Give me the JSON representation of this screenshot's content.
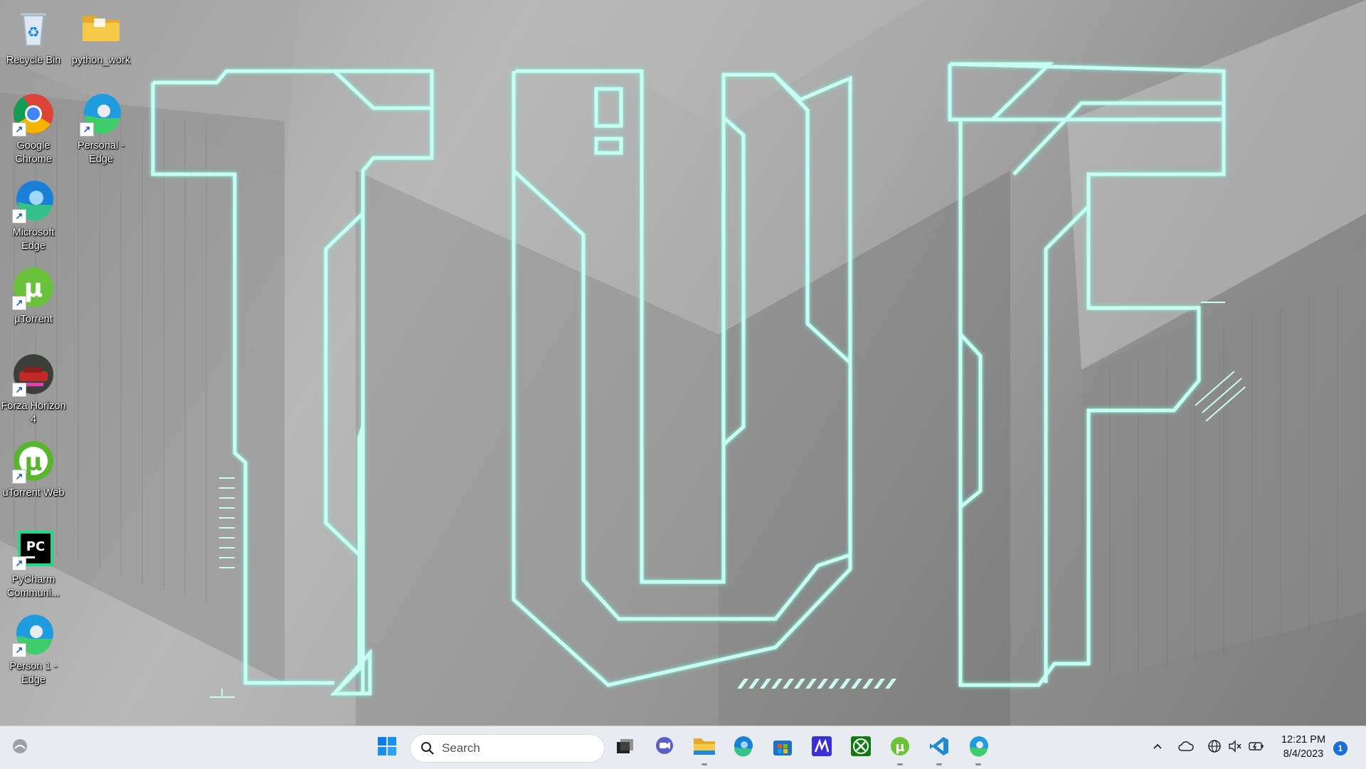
{
  "desktop": {
    "wallpaper_text": "TUF",
    "accent_color": "#c9fff2",
    "icons": [
      {
        "label": "Recycle Bin",
        "icon": "recycle-bin-icon",
        "shortcut": false
      },
      {
        "label": "python_work",
        "icon": "folder-icon",
        "shortcut": false
      },
      {
        "label": "Google Chrome",
        "icon": "chrome-icon",
        "shortcut": true
      },
      {
        "label": "Personal - Edge",
        "icon": "edge-profile-icon",
        "shortcut": true
      },
      {
        "label": "Microsoft Edge",
        "icon": "edge-icon",
        "shortcut": true
      },
      {
        "label": "µTorrent",
        "icon": "utorrent-icon",
        "shortcut": true
      },
      {
        "label": "Forza Horizon 4",
        "icon": "forza-icon",
        "shortcut": true
      },
      {
        "label": "uTorrent Web",
        "icon": "utorrent-web-icon",
        "shortcut": true
      },
      {
        "label": "PyCharm Communi...",
        "icon": "pycharm-icon",
        "shortcut": true
      },
      {
        "label": "Person 1 - Edge",
        "icon": "edge-profile-icon",
        "shortcut": true
      }
    ]
  },
  "taskbar": {
    "search": {
      "placeholder": "Search"
    },
    "pinned": [
      {
        "name": "start-button",
        "icon": "windows-logo-icon",
        "running": false
      },
      {
        "name": "task-view-button",
        "icon": "task-view-icon",
        "running": false
      },
      {
        "name": "chat-button",
        "icon": "chat-icon",
        "running": false
      },
      {
        "name": "file-explorer-button",
        "icon": "folder-icon",
        "running": true
      },
      {
        "name": "edge-button",
        "icon": "edge-icon",
        "running": false
      },
      {
        "name": "store-button",
        "icon": "store-icon",
        "running": false
      },
      {
        "name": "mathpix-button",
        "icon": "m-app-icon",
        "running": false
      },
      {
        "name": "xbox-button",
        "icon": "xbox-icon",
        "running": false
      },
      {
        "name": "utorrent-button",
        "icon": "utorrent-icon",
        "running": true
      },
      {
        "name": "vscode-button",
        "icon": "vscode-icon",
        "running": true
      },
      {
        "name": "edge-profile-button",
        "icon": "edge-profile-icon",
        "running": true
      }
    ],
    "tray": {
      "time": "12:21 PM",
      "date": "8/4/2023",
      "notifications": "1"
    }
  }
}
